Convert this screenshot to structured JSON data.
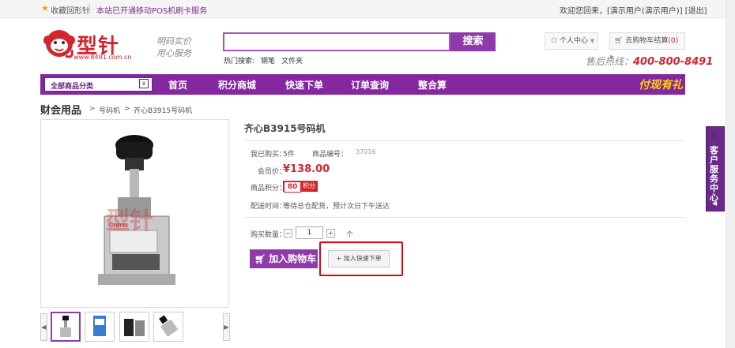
{
  "topbar": {
    "favorite": "收藏回形针",
    "pos_service": "本站已开通移动POS机刷卡服务",
    "welcome": "欢迎您回来，[演示用户(演示用户)] [退出]"
  },
  "header": {
    "logo_text": "型针",
    "logo_url": "www.8491.com.cn",
    "slogan_1": "明码实价",
    "slogan_2": "用心服务",
    "search_placeholder": "",
    "search_button": "搜索",
    "hot_label": "热门搜索:",
    "hot_terms": [
      "钢笔",
      "文件夹"
    ],
    "user_center": "个人中心",
    "cart": "去购物车结算",
    "cart_count": "(0)",
    "hotline_label": "售后热线：",
    "hotline_number": "400-800-8491"
  },
  "nav": {
    "all_categories": "全部商品分类",
    "items": [
      "首页",
      "积分商城",
      "快速下单",
      "订单查询",
      "整合算"
    ],
    "promo": "付现有礼"
  },
  "breadcrumb": {
    "main": "财会用品",
    "items": [
      "号码机",
      "齐心B3915号码机"
    ]
  },
  "product": {
    "title": "齐心B3915号码机",
    "purchased_label": "我已购买：",
    "purchased_value": "5件",
    "code_label": "商品编号：",
    "code_value": "37016",
    "member_price_label": "会员价：",
    "member_price": "¥138.00",
    "points_label": "商品积分：",
    "points_value": "80",
    "points_unit": "积分",
    "delivery_label": "配送时间：",
    "delivery_value": "等待总仓配货，预计次日下午送达",
    "quantity_label": "购买数量：",
    "quantity_value": "1",
    "quantity_unit": "个",
    "add_cart": "加入购物车",
    "quick_order": "加入快速下单",
    "watermark": "型针"
  },
  "service": {
    "label": "客户服务中心"
  },
  "colors": {
    "brand_purple": "#85289f",
    "brand_red": "#d4262e",
    "highlight_red": "#e60012"
  }
}
